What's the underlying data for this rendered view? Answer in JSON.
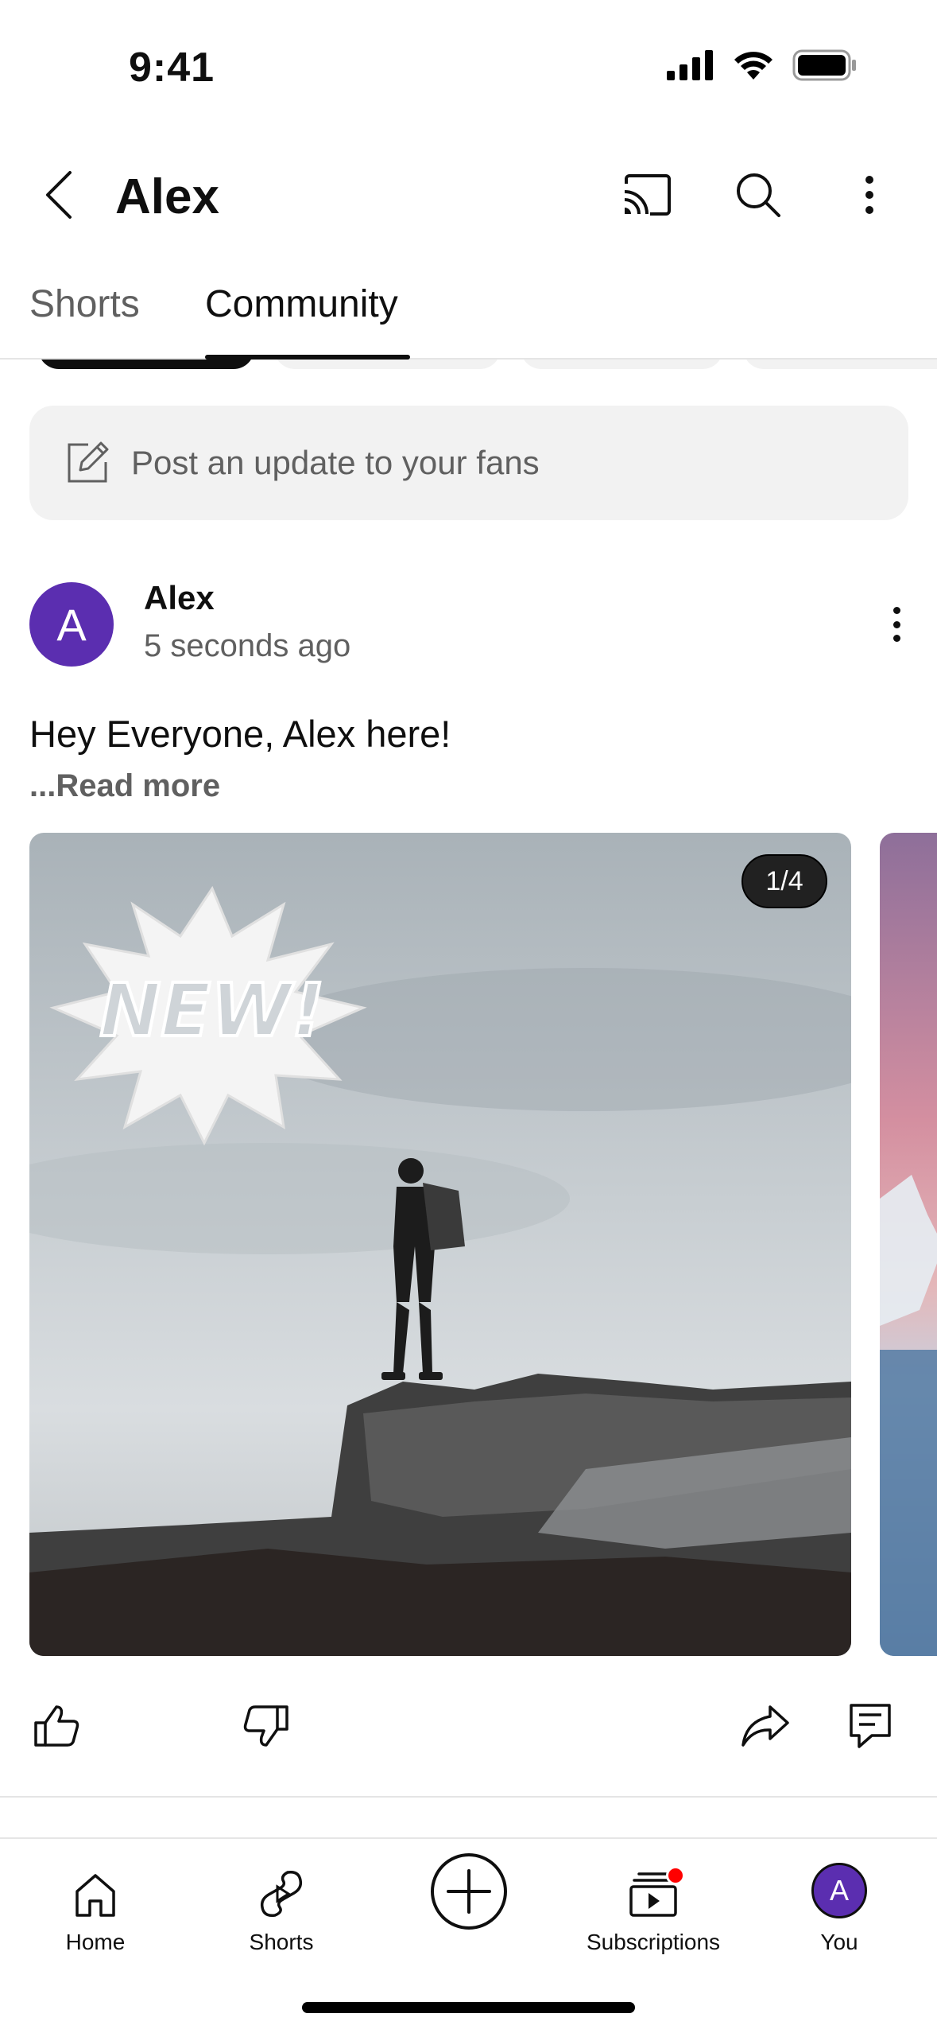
{
  "status_bar": {
    "time": "9:41"
  },
  "header": {
    "title": "Alex"
  },
  "tabs": [
    {
      "label": "Shorts",
      "active": false
    },
    {
      "label": "Community",
      "active": true
    }
  ],
  "composer": {
    "placeholder": "Post an update to your fans"
  },
  "post": {
    "avatar_letter": "A",
    "author": "Alex",
    "time": "5 seconds ago",
    "text": "Hey Everyone, Alex here!",
    "read_more": "...Read more",
    "image_counter": "1/4",
    "image_sticker_text": "NEW!"
  },
  "bottom_nav": {
    "home": "Home",
    "shorts": "Shorts",
    "subscriptions": "Subscriptions",
    "you": "You",
    "you_avatar_letter": "A"
  },
  "colors": {
    "avatar": "#5b2eb0",
    "notification_dot": "#ff0000",
    "text_primary": "#0f0f0f",
    "text_secondary": "#606060"
  }
}
